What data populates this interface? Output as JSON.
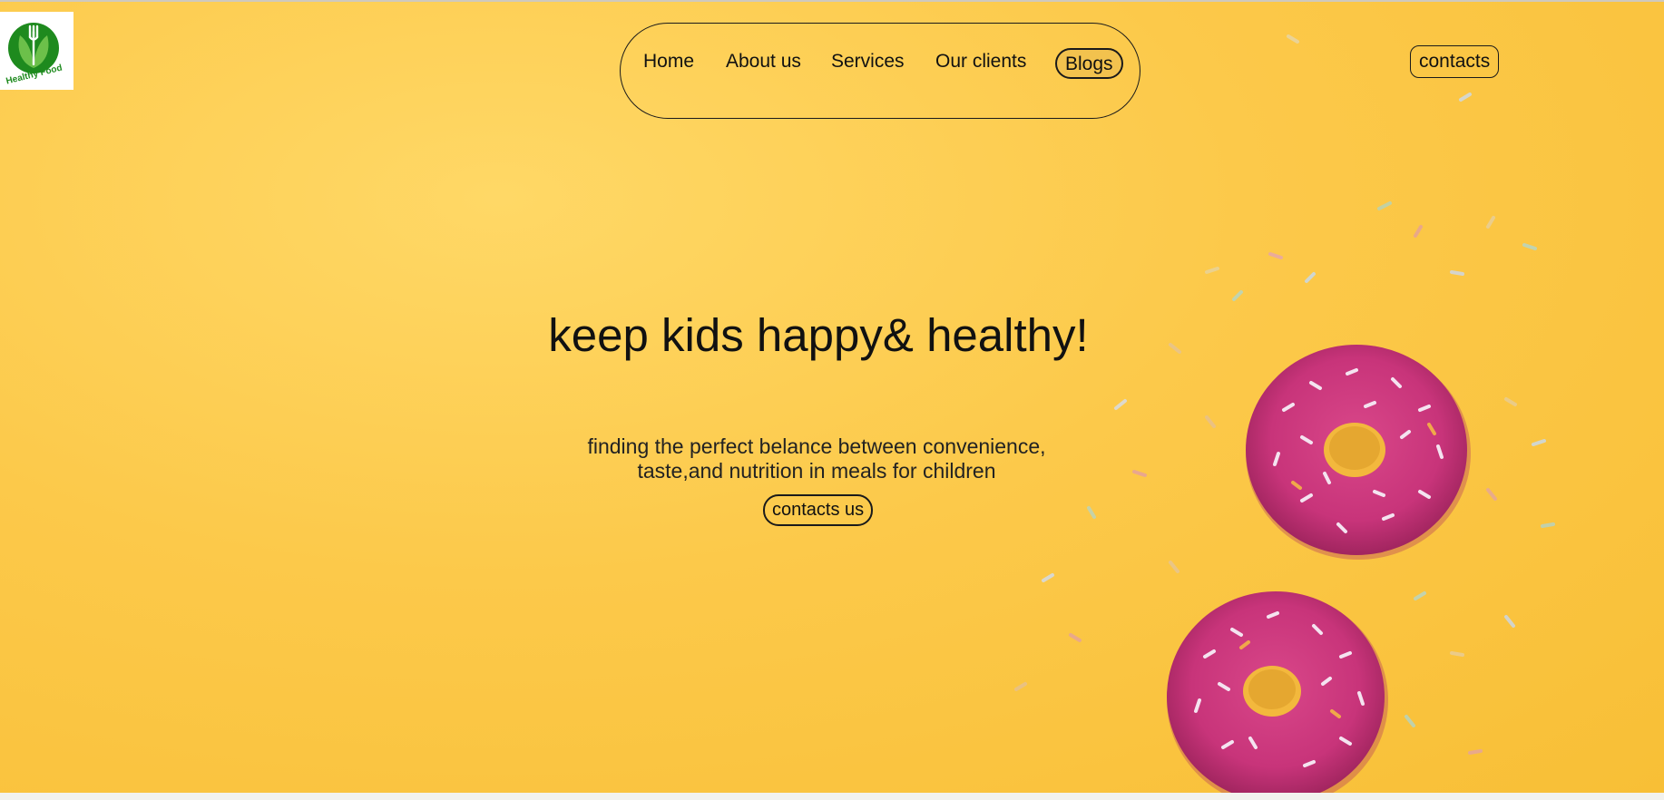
{
  "logo": {
    "text": "Healthy Food",
    "icon": "fork-leaf-icon",
    "color": "#1e8a1e"
  },
  "nav": {
    "items": [
      "Home",
      "About us",
      "Services",
      "Our clients"
    ],
    "blogs_label": "Blogs"
  },
  "header": {
    "contacts_label": "contacts"
  },
  "hero": {
    "headline": "keep kids happy& healthy!",
    "subtitle_line1": "finding the perfect belance between convenience,",
    "subtitle_line2": "taste,and nutrition in meals for children",
    "cta_label": "contacts us",
    "background_color": "#fcc94a",
    "donut_color": "#c8347a",
    "image": "pink-donuts-with-sprinkles"
  }
}
